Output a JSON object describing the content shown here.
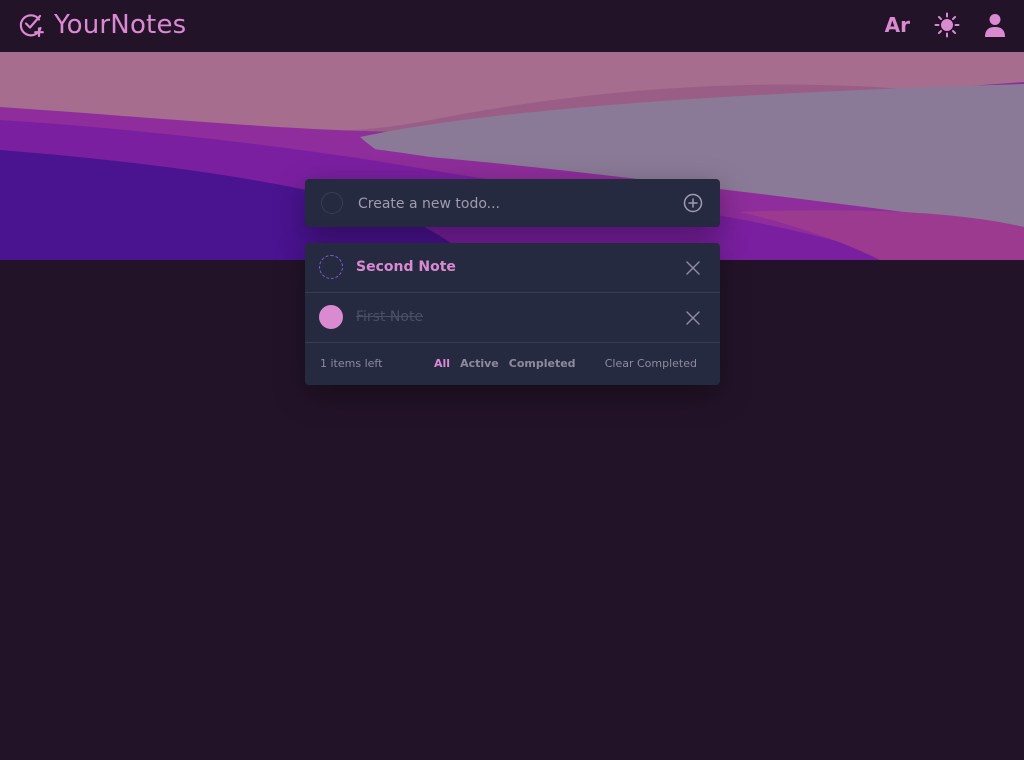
{
  "app": {
    "title": "YourNotes",
    "brand_icon": "check-circle-plus-icon"
  },
  "header": {
    "language_label": "Ar",
    "theme_icon": "sun-icon",
    "profile_icon": "user-icon"
  },
  "new_todo": {
    "placeholder": "Create a new todo...",
    "add_icon": "plus-circle-icon"
  },
  "todos": [
    {
      "text": "Second Note",
      "completed": false
    },
    {
      "text": "First Note",
      "completed": true
    }
  ],
  "footer": {
    "items_left": "1 items left",
    "filters": [
      "All",
      "Active",
      "Completed"
    ],
    "active_filter": "All",
    "clear_label": "Clear Completed"
  },
  "colors": {
    "background": "#231329",
    "card": "#262a40",
    "accent": "#d98ad1",
    "accent_secondary": "#7b5ad1",
    "muted_text": "#8e8aa0"
  }
}
